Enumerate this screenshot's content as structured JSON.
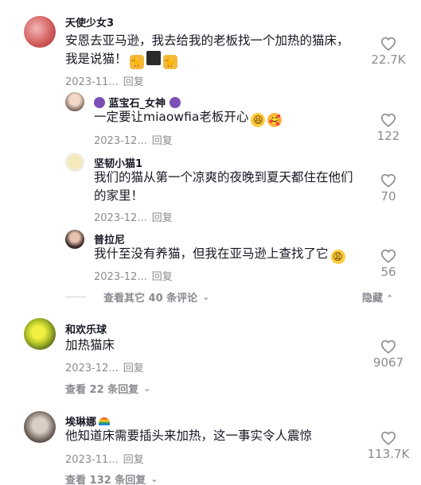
{
  "comments": [
    {
      "username": "天使少女3",
      "text_line1": "安恩去亚马逊，我去给我的老板找一个加热的猫床，",
      "text_line2": "我是说猫！",
      "emoji1": "cat-emoji",
      "emoji2": "black-square-emoji",
      "emoji3": "cat-emoji",
      "date": "2023-11...",
      "reply": "回复",
      "likes": "22.7K",
      "replies": [
        {
          "username": "蓝宝石_女神",
          "text": "一定要让miaowfia老板开心",
          "date": "2023-12...",
          "reply": "回复",
          "likes": "122"
        },
        {
          "username": "坚韧小猫1",
          "text_line1": "我们的猫从第一个凉爽的夜晚到夏天都住在他们",
          "text_line2": "的家里！",
          "date": "2023-12...",
          "reply": "回复",
          "likes": "70"
        },
        {
          "username": "普拉尼",
          "text": "我什至没有养猫，但我在亚马逊上查找了它",
          "date": "2023-12...",
          "reply": "回复",
          "likes": "56"
        }
      ],
      "view_more": "查看其它 40 条评论",
      "hide": "隐藏"
    },
    {
      "username": "和欢乐球",
      "text": "加热猫床",
      "date": "2023-12...",
      "reply": "回复",
      "likes": "9067",
      "view_replies": "查看 22 条回复"
    },
    {
      "username": "埃琳娜",
      "text": "他知道床需要插头来加热，这一事实令人震惊",
      "date": "2023-11...",
      "reply": "回复",
      "likes": "113.7K",
      "view_replies": "查看 132 条回复"
    }
  ],
  "icons": {
    "heart": "heart-outline-icon",
    "chevron": "chevron-down-icon",
    "chevron_up": "chevron-up-icon"
  },
  "colors": {
    "text": "#161823",
    "secondary": "#8a8b91"
  }
}
